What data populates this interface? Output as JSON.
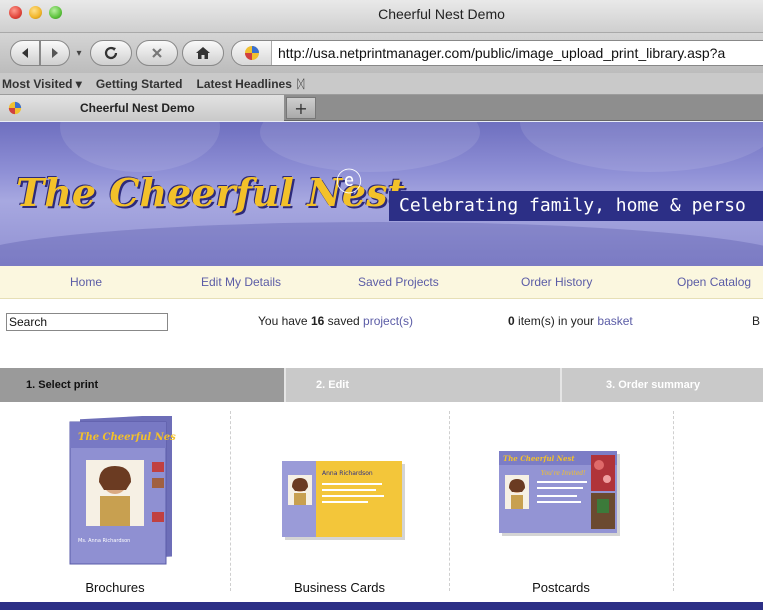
{
  "window": {
    "title": "Cheerful Nest Demo"
  },
  "toolbar": {
    "url": "http://usa.netprintmanager.com/public/image_upload_print_library.asp?a"
  },
  "bookmarks": {
    "items": [
      "Most Visited ▾",
      "Getting Started",
      "Latest Headlines"
    ]
  },
  "tabs": {
    "active": "Cheerful Nest Demo",
    "new_tab": "+"
  },
  "banner": {
    "logo_text": "The Cheerful Nest",
    "tagline": "Celebrating family, home & perso"
  },
  "nav": {
    "items": [
      "Home",
      "Edit My Details",
      "Saved Projects",
      "Order History",
      "Open Catalog"
    ]
  },
  "info": {
    "search_value": "Search",
    "saved_prefix": "You have",
    "saved_count": "16",
    "saved_middle": "saved",
    "saved_link": "project(s)",
    "basket_count": "0",
    "basket_text": "item(s) in your",
    "basket_link": "basket",
    "trailing": "B"
  },
  "steps": [
    "1. Select print",
    "2. Edit",
    "3. Order summary"
  ],
  "products": [
    {
      "label": "Brochures",
      "thumb_title": "The Cheerful Nest",
      "thumb_name": "Ms. Anna Richardson"
    },
    {
      "label": "Business Cards",
      "thumb_name": "Anna Richardson"
    },
    {
      "label": "Postcards",
      "thumb_title": "The Cheerful Nest",
      "thumb_greeting": "You're Invited!"
    }
  ],
  "colors": {
    "brand": "#2c2f86",
    "accent": "#f3c12a",
    "banner": "#8f90d6",
    "nav_bg": "#fbf7df",
    "link": "#5b5ca6"
  }
}
